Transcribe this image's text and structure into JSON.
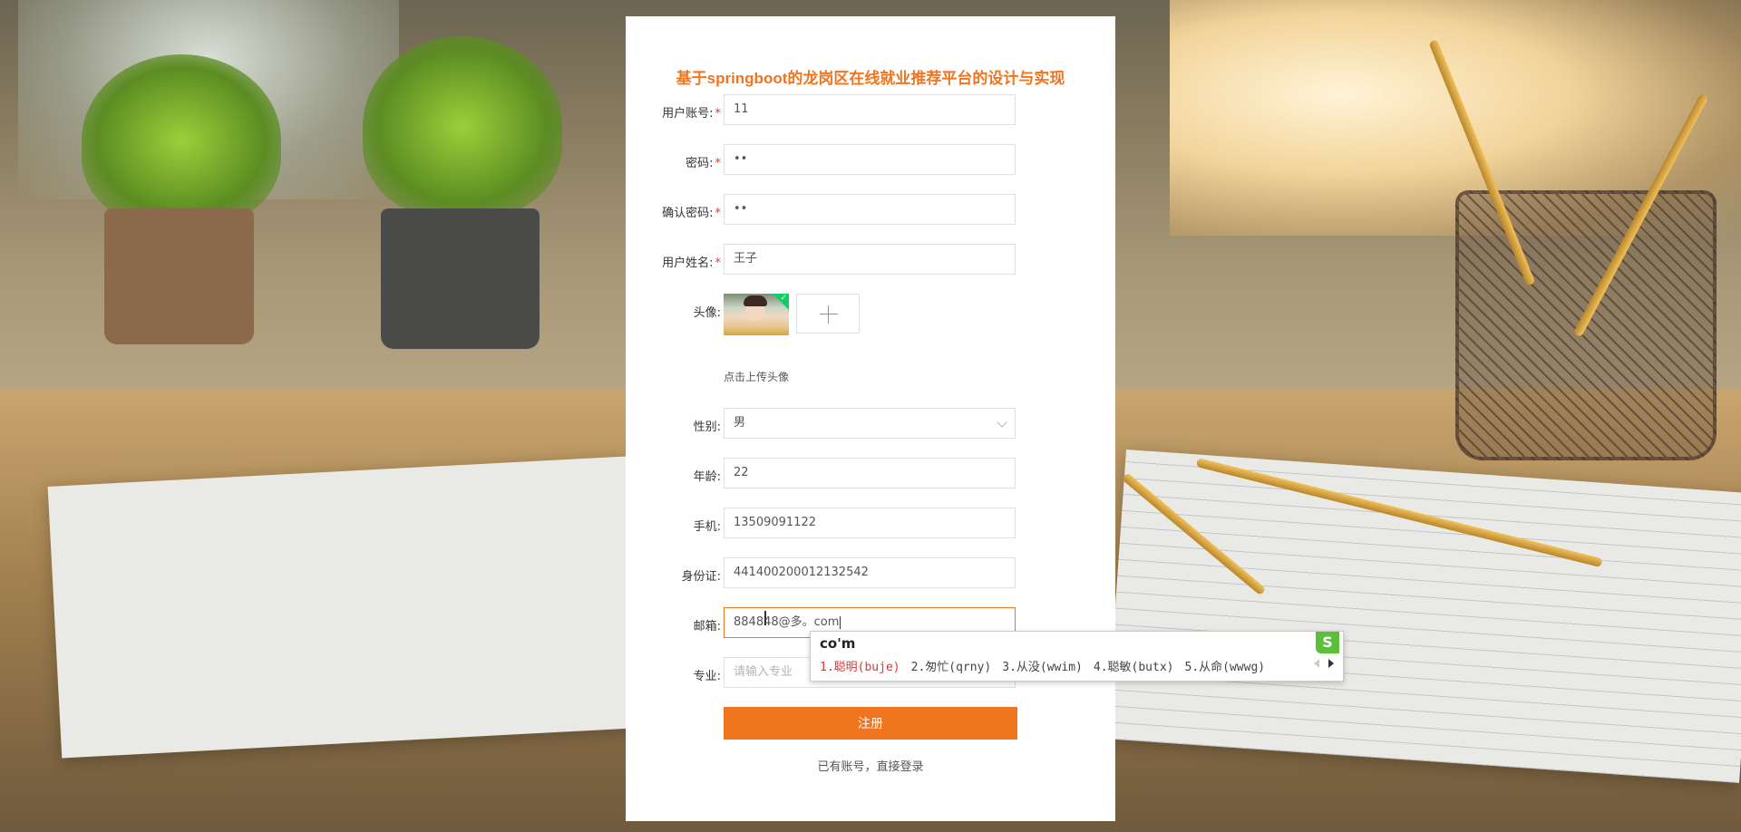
{
  "form": {
    "title": "基于springboot的龙岗区在线就业推荐平台的设计与实现",
    "fields": {
      "username": {
        "label": "用户账号:",
        "value": "11",
        "required": true
      },
      "password": {
        "label": "密码:",
        "value": "••",
        "required": true
      },
      "confirm_password": {
        "label": "确认密码:",
        "value": "••",
        "required": true
      },
      "realname": {
        "label": "用户姓名:",
        "value": "王子",
        "required": true
      },
      "avatar": {
        "label": "头像:",
        "hint": "点击上传头像"
      },
      "gender": {
        "label": "性别:",
        "value": "男"
      },
      "age": {
        "label": "年龄:",
        "value": "22"
      },
      "phone": {
        "label": "手机:",
        "value": "13509091122"
      },
      "idcard": {
        "label": "身份证:",
        "value": "441400200012132542"
      },
      "email": {
        "label": "邮箱:",
        "value": "884848@多。com"
      },
      "major": {
        "label": "专业:",
        "placeholder": "请输入专业"
      }
    },
    "required_mark": "*",
    "submit_label": "注册",
    "login_link": "已有账号，直接登录"
  },
  "ime": {
    "composition": "co'm",
    "candidates": [
      "1.聪明(buje)",
      "2.匆忙(qrny)",
      "3.从没(wwim)",
      "4.聪敏(butx)",
      "5.从命(wwwg)"
    ],
    "logo": "S"
  },
  "colors": {
    "accent": "#f0751e",
    "required": "#e5322d"
  }
}
